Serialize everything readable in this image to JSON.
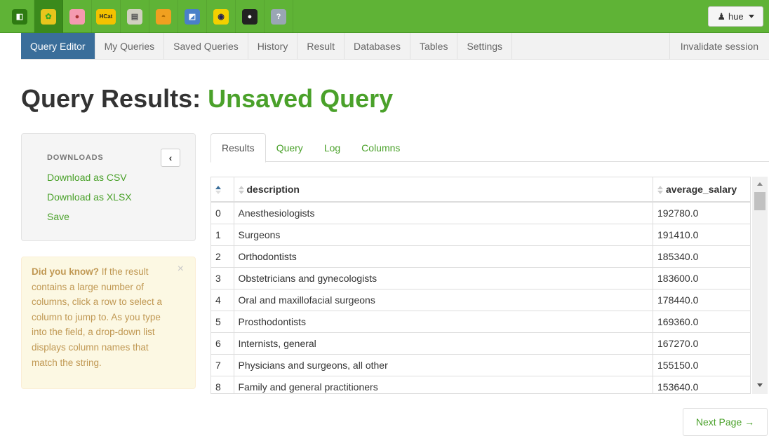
{
  "topbar": {
    "color": "#5fb336",
    "apps": [
      {
        "name": "hue-logo-icon",
        "bg": "#2e7a12",
        "fg": "#fff",
        "glyph": "◧"
      },
      {
        "name": "beeswax-icon",
        "bg": "#e8c51c",
        "fg": "#3a2",
        "glyph": "✿"
      },
      {
        "name": "pig-icon",
        "bg": "#f59ab0",
        "fg": "#a33",
        "glyph": "●"
      },
      {
        "name": "hcat-icon",
        "bg": "#f2c200",
        "fg": "#222",
        "glyph": "HCat"
      },
      {
        "name": "file-browser-icon",
        "bg": "#d0d0c0",
        "fg": "#555",
        "glyph": "▤"
      },
      {
        "name": "job-designer-icon",
        "bg": "#f0a020",
        "fg": "#a60",
        "glyph": "◓"
      },
      {
        "name": "oozie-icon",
        "bg": "#4a80c8",
        "fg": "#fff",
        "glyph": "◩"
      },
      {
        "name": "job-browser-icon",
        "bg": "#f3d000",
        "fg": "#225",
        "glyph": "◉"
      },
      {
        "name": "user-admin-icon",
        "bg": "#222",
        "fg": "#fff",
        "glyph": "●"
      },
      {
        "name": "help-icon",
        "bg": "#9aa6b4",
        "fg": "#fff",
        "glyph": "?"
      }
    ],
    "user_label": "hue"
  },
  "subnav": {
    "items": [
      "Query Editor",
      "My Queries",
      "Saved Queries",
      "History",
      "Result",
      "Databases",
      "Tables",
      "Settings"
    ],
    "active_index": 0,
    "right_label": "Invalidate session"
  },
  "title": {
    "prefix": "Query Results: ",
    "name": "Unsaved Query"
  },
  "downloads": {
    "header": "DOWNLOADS",
    "links": [
      "Download as CSV",
      "Download as XLSX",
      "Save"
    ]
  },
  "tip": {
    "bold": "Did you know?",
    "text": " If the result contains a large number of columns, click a row to select a column to jump to. As you type into the field, a drop-down list displays column names that match the string."
  },
  "tabs": [
    "Results",
    "Query",
    "Log",
    "Columns"
  ],
  "table": {
    "columns": [
      "description",
      "average_salary"
    ],
    "rows": [
      [
        "0",
        "Anesthesiologists",
        "192780.0"
      ],
      [
        "1",
        "Surgeons",
        "191410.0"
      ],
      [
        "2",
        "Orthodontists",
        "185340.0"
      ],
      [
        "3",
        "Obstetricians and gynecologists",
        "183600.0"
      ],
      [
        "4",
        "Oral and maxillofacial surgeons",
        "178440.0"
      ],
      [
        "5",
        "Prosthodontists",
        "169360.0"
      ],
      [
        "6",
        "Internists, general",
        "167270.0"
      ],
      [
        "7",
        "Physicians and surgeons, all other",
        "155150.0"
      ],
      [
        "8",
        "Family and general practitioners",
        "153640.0"
      ]
    ]
  },
  "pagination": {
    "next_label": "Next Page →"
  }
}
